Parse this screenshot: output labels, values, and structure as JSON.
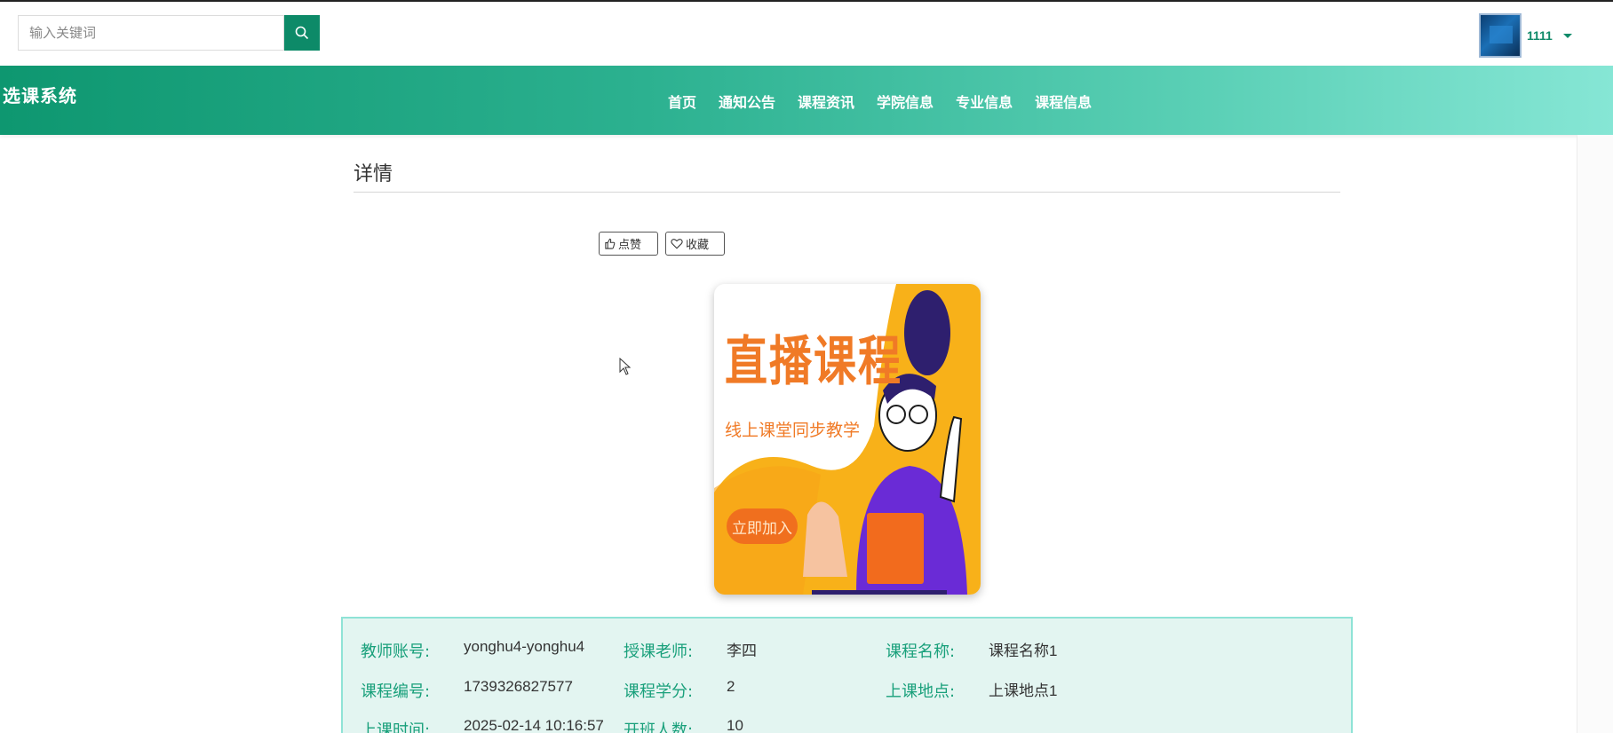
{
  "search": {
    "placeholder": "输入关键词"
  },
  "user": {
    "name": "1111"
  },
  "brand": "选课系统",
  "nav": {
    "items": [
      {
        "label": "首页"
      },
      {
        "label": "通知公告"
      },
      {
        "label": "课程资讯"
      },
      {
        "label": "学院信息"
      },
      {
        "label": "专业信息"
      },
      {
        "label": "课程信息"
      }
    ]
  },
  "detail": {
    "title": "详情",
    "like_label": "点赞",
    "favorite_label": "收藏"
  },
  "course_image": {
    "title": "直播课程",
    "subtitle": "线上课堂同步教学",
    "join_label": "立即加入"
  },
  "info": {
    "teacher_account": {
      "label": "教师账号:",
      "value": "yonghu4-yonghu4"
    },
    "teacher_name": {
      "label": "授课老师:",
      "value": "李四"
    },
    "course_name": {
      "label": "课程名称:",
      "value": "课程名称1"
    },
    "course_code": {
      "label": "课程编号:",
      "value": "1739326827577"
    },
    "credits": {
      "label": "课程学分:",
      "value": "2"
    },
    "location": {
      "label": "上课地点:",
      "value": "上课地点1"
    },
    "class_time": {
      "label": "上课时间:",
      "value": "2025-02-14 10:16:57"
    },
    "class_size": {
      "label": "开班人数:",
      "value": "10"
    }
  },
  "colors": {
    "accent": "#0d8a68",
    "nav_gradient_start": "#0e9770",
    "nav_gradient_end": "#86e6d5",
    "info_label": "#19a07b",
    "info_bg": "#e3f5f1",
    "image_orange": "#f07a26",
    "image_yellow": "#f8b119",
    "image_purple": "#6a2bd6"
  },
  "icons": {
    "search": "search-icon",
    "like": "thumbs-up-icon",
    "favorite": "heart-icon",
    "dropdown": "chevron-down-icon"
  }
}
